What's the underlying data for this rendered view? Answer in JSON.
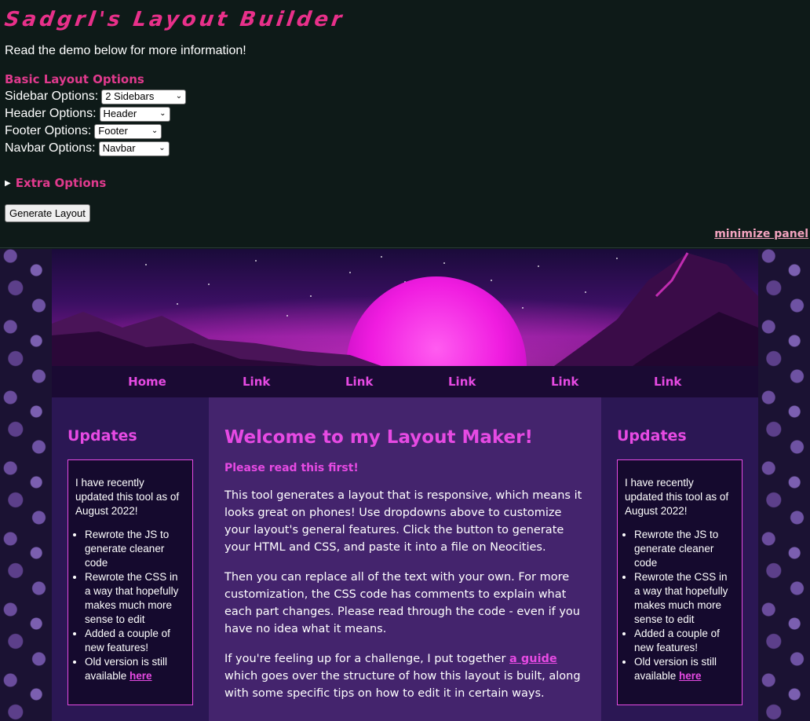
{
  "panel": {
    "title": "Sadgrl's Layout Builder",
    "intro": "Read the demo below for more information!",
    "basic_heading": "Basic Layout Options",
    "options": [
      {
        "label": "Sidebar Options:",
        "value": "2 Sidebars"
      },
      {
        "label": "Header Options:",
        "value": "Header"
      },
      {
        "label": "Footer Options:",
        "value": "Footer"
      },
      {
        "label": "Navbar Options:",
        "value": "Navbar"
      }
    ],
    "extra_label": "Extra Options",
    "generate_label": "Generate Layout",
    "minimize_label": "minimize panel"
  },
  "nav": {
    "links": [
      "Home",
      "Link",
      "Link",
      "Link",
      "Link",
      "Link"
    ]
  },
  "left_sidebar": {
    "heading": "Updates",
    "intro": "I have recently updated this tool as of August 2022!",
    "items": [
      "Rewrote the JS to generate cleaner code",
      "Rewrote the CSS in a way that hopefully makes much more sense to edit",
      "Added a couple of new features!"
    ],
    "last_item_text": "Old version is still available ",
    "last_item_link": "here"
  },
  "right_sidebar": {
    "heading": "Updates",
    "intro": "I have recently updated this tool as of August 2022!",
    "items": [
      "Rewrote the JS to generate cleaner code",
      "Rewrote the CSS in a way that hopefully makes much more sense to edit",
      "Added a couple of new features!"
    ],
    "last_item_text": "Old version is still available ",
    "last_item_link": "here"
  },
  "main": {
    "heading": "Welcome to my Layout Maker!",
    "note": "Please read this first!",
    "p1": "This tool generates a layout that is responsive, which means it looks great on phones! Use dropdowns above to customize your layout's general features. Click the button to generate your HTML and CSS, and paste it into a file on Neocities.",
    "p2": "Then you can replace all of the text with your own. For more customization, the CSS code has comments to explain what each part changes. Please read through the code - even if you have no idea what it means.",
    "p3_before": "If you're feeling up for a challenge, I put together ",
    "p3_link": "a guide",
    "p3_after": " which goes over the structure of how this layout is built, along with some specific tips on how to edit it in certain ways."
  },
  "colors": {
    "accent_pink": "#e64ae3",
    "title_pink": "#e8308a",
    "panel_bg": "#0e1a18",
    "sidebar_bg": "#2b1754",
    "main_bg": "#44246d",
    "nav_bg": "#1a0a33"
  }
}
